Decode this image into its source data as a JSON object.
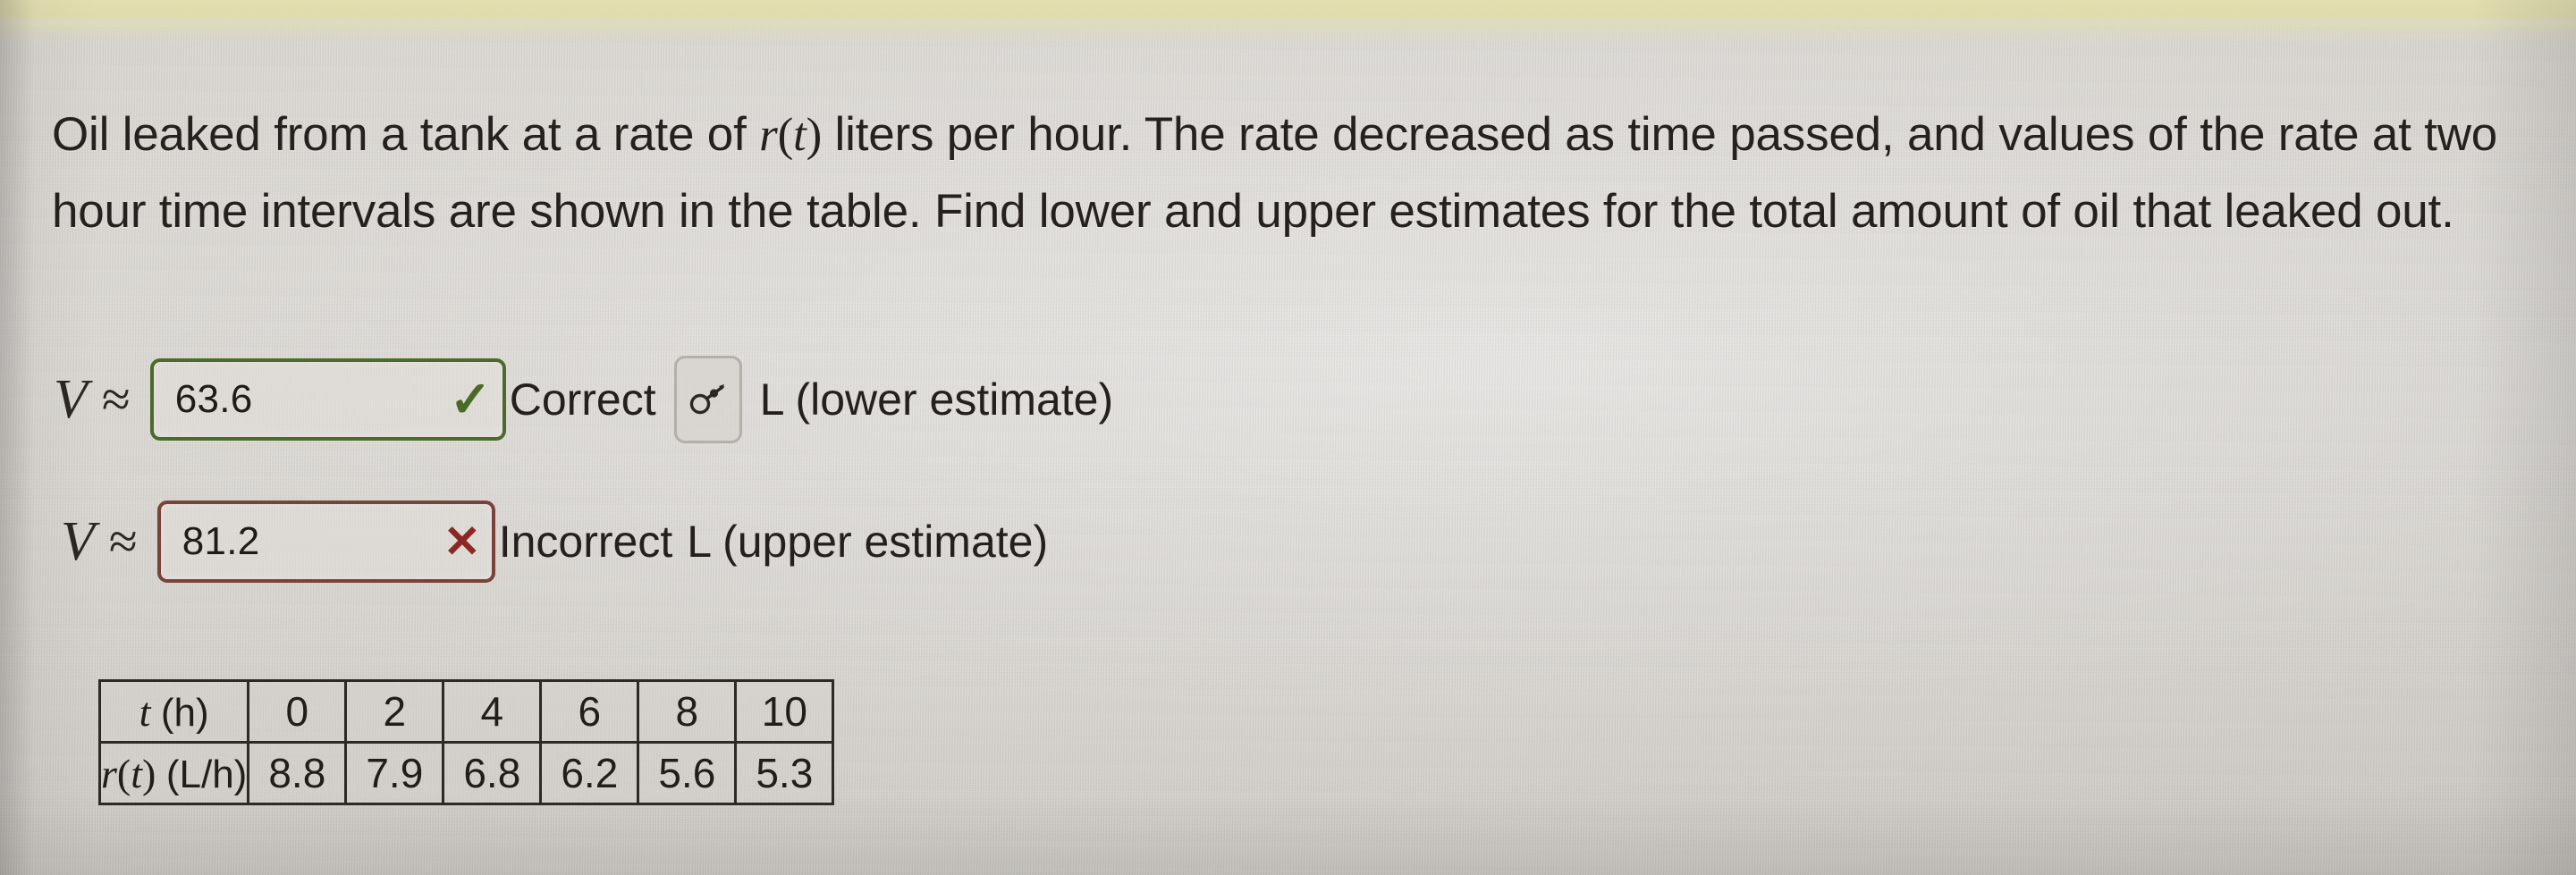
{
  "problem": {
    "text_part_1": "Oil leaked from a tank at a rate of ",
    "math_r": "r",
    "math_t": "t",
    "text_part_2": " liters per hour. The rate decreased as time passed, and values of the rate at two hour time intervals are shown in the table. Find lower and upper estimates for the total amount of oil that leaked out."
  },
  "answers": {
    "lower": {
      "symbol_v": "V",
      "symbol_approx": "≈",
      "value": "63.6",
      "mark_glyph": "✓",
      "mark_name": "check-mark",
      "verdict": "Correct",
      "key_button_name": "key-icon",
      "unit_label": "L (lower estimate)",
      "border_color": "#4c6b2b",
      "mark_color": "#4a6b28"
    },
    "upper": {
      "symbol_v": "V",
      "symbol_approx": "≈",
      "value": "81.2",
      "mark_glyph": "✕",
      "mark_name": "cross-mark",
      "verdict": "Incorrect",
      "unit_label": "L (upper estimate)",
      "border_color": "#7a4238",
      "mark_color": "#8c2822"
    }
  },
  "chart_data": {
    "type": "table",
    "title": "",
    "row_labels": [
      "t (h)",
      "r(t) (L/h)"
    ],
    "row_label_parts": {
      "t_var": "t",
      "t_unit": "(h)",
      "r_var": "r",
      "r_arg": "(t)",
      "r_unit": "(L/h)"
    },
    "x": [
      0,
      2,
      4,
      6,
      8,
      10
    ],
    "values": [
      8.8,
      7.9,
      6.8,
      6.2,
      5.6,
      5.3
    ],
    "x_display": [
      "0",
      "2",
      "4",
      "6",
      "8",
      "10"
    ],
    "values_display": [
      "8.8",
      "7.9",
      "6.8",
      "6.2",
      "5.6",
      "5.3"
    ],
    "xlabel": "t (h)",
    "ylabel": "r(t) (L/h)"
  },
  "theme": {
    "background": "#d6d3cd",
    "top_strip": "#e0dcaa",
    "text": "#231f1c"
  }
}
